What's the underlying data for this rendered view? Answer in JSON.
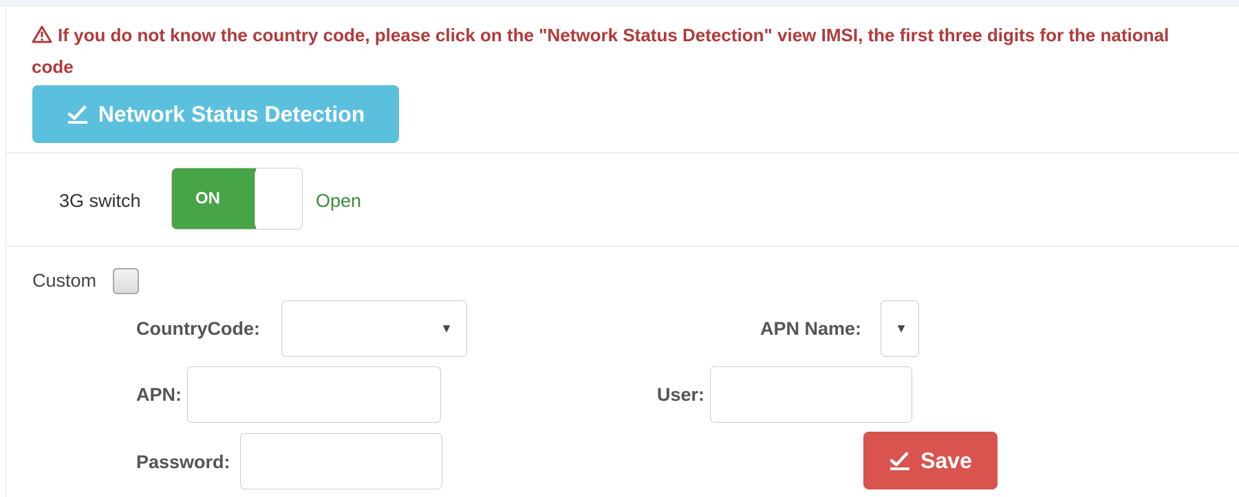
{
  "warning": {
    "icon": "warning-triangle-icon",
    "text": "If you do not know the country code, please click on the \"Network Status Detection\" view IMSI, the first three digits for the national code",
    "color": "#b23a3a"
  },
  "detect_button": {
    "icon": "check-edit-icon",
    "label": "Network Status Detection",
    "color": "#5bc0de"
  },
  "switch_3g": {
    "label": "3G switch",
    "toggle_label": "ON",
    "status": "Open",
    "on_color": "#47a447",
    "is_on": true
  },
  "custom": {
    "label": "Custom",
    "checked": false
  },
  "form": {
    "country_code_label": "CountryCode:",
    "country_code_value": "",
    "apn_name_label": "APN Name:",
    "apn_name_value": "",
    "apn_label": "APN:",
    "apn_value": "",
    "user_label": "User:",
    "user_value": "",
    "password_label": "Password:",
    "password_value": "",
    "dropdown_arrow": "▼"
  },
  "save_button": {
    "icon": "check-edit-icon",
    "label": "Save",
    "color": "#d9534f"
  }
}
